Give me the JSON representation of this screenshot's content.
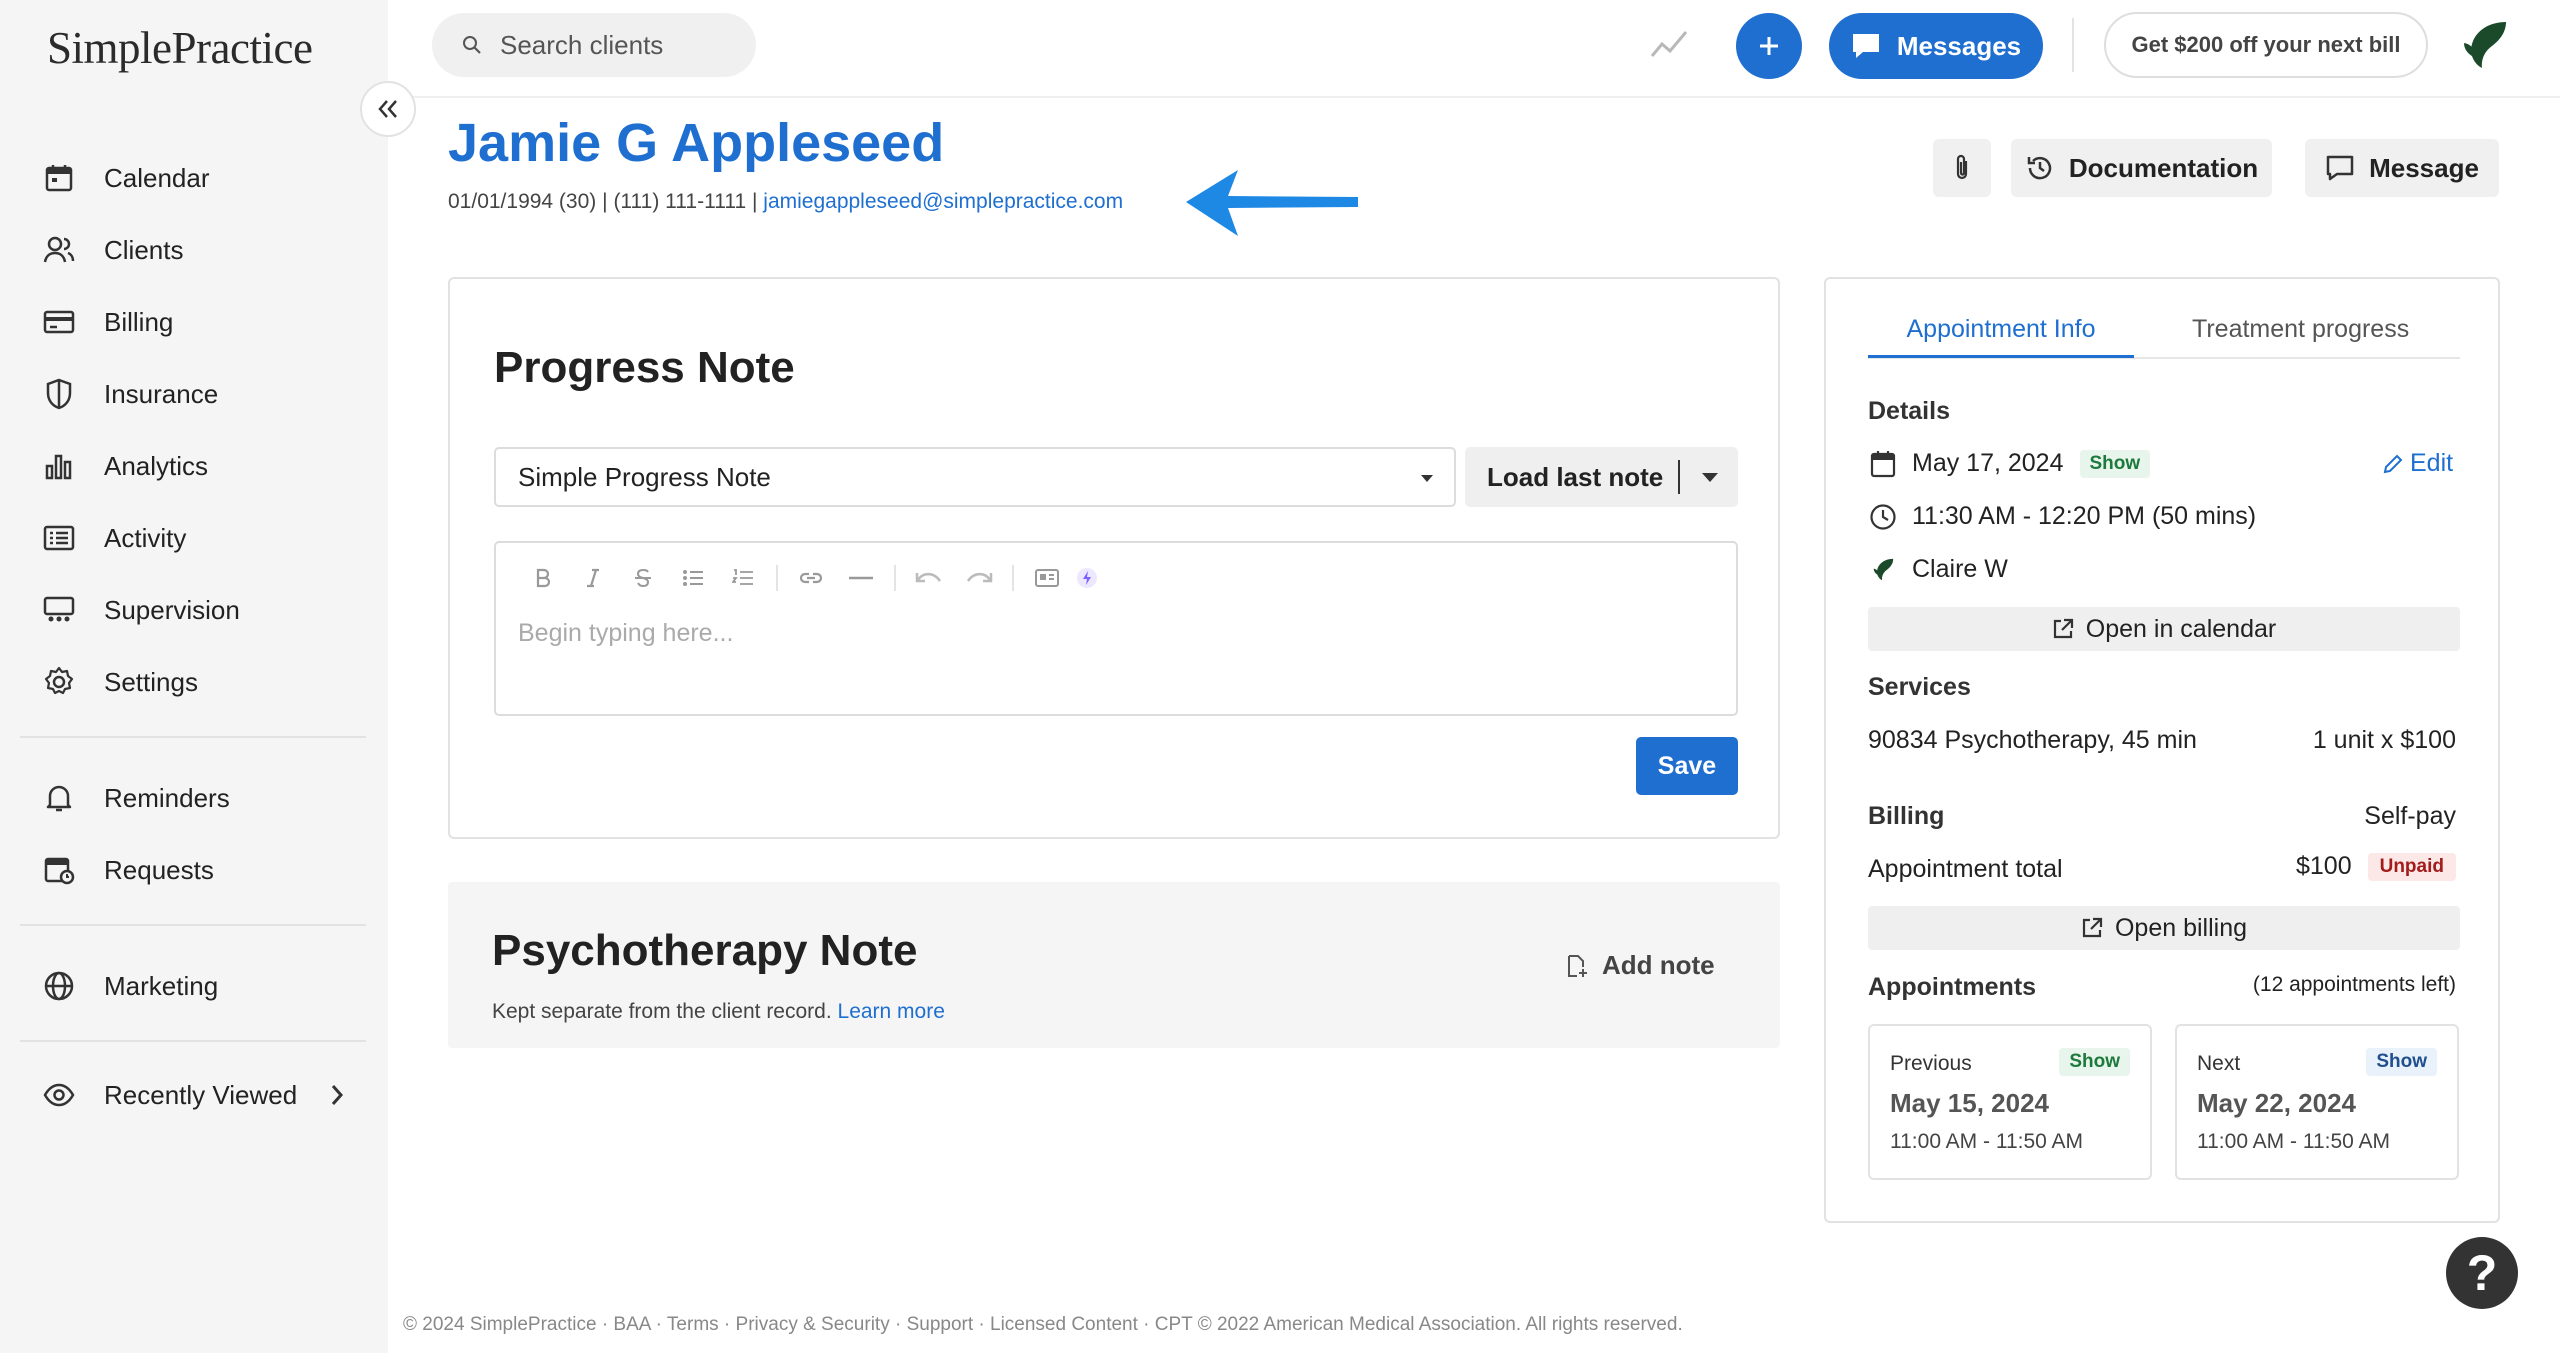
{
  "app": {
    "logo": "SimplePractice"
  },
  "sidebar": {
    "items": [
      {
        "label": "Calendar"
      },
      {
        "label": "Clients"
      },
      {
        "label": "Billing"
      },
      {
        "label": "Insurance"
      },
      {
        "label": "Analytics"
      },
      {
        "label": "Activity"
      },
      {
        "label": "Supervision"
      },
      {
        "label": "Settings"
      },
      {
        "label": "Reminders"
      },
      {
        "label": "Requests"
      },
      {
        "label": "Marketing"
      },
      {
        "label": "Recently Viewed"
      }
    ]
  },
  "header": {
    "search_placeholder": "Search clients",
    "messages_label": "Messages",
    "promo_label": "Get $200 off your next bill"
  },
  "client": {
    "name": "Jamie G Appleseed",
    "dob": "01/01/1994 (30)",
    "phone": "(111) 111-1111",
    "email": "jamiegappleseed@simplepractice.com",
    "documentation_label": "Documentation",
    "message_label": "Message"
  },
  "progress_note": {
    "title": "Progress Note",
    "template": "Simple Progress Note",
    "load_last_label": "Load last note",
    "placeholder": "Begin typing here...",
    "save_label": "Save"
  },
  "psychotherapy_note": {
    "title": "Psychotherapy Note",
    "subtitle": "Kept separate from the client record.",
    "learn_more": "Learn more",
    "add_note_label": "Add note"
  },
  "panel": {
    "tabs": [
      "Appointment Info",
      "Treatment progress"
    ],
    "details_heading": "Details",
    "date": "May 17, 2024",
    "status": "Show",
    "edit_label": "Edit",
    "time": "11:30 AM - 12:20 PM (50 mins)",
    "clinician": "Claire W",
    "open_calendar": "Open in calendar",
    "services_heading": "Services",
    "service": "90834 Psychotherapy, 45 min",
    "service_units": "1 unit x $100",
    "billing_heading": "Billing",
    "billing_type": "Self-pay",
    "appointment_total_label": "Appointment total",
    "appointment_total": "$100",
    "payment_status": "Unpaid",
    "open_billing": "Open billing",
    "appointments_heading": "Appointments",
    "appointments_left": "(12 appointments left)",
    "previous": {
      "label": "Previous",
      "status": "Show",
      "date": "May 15, 2024",
      "time": "11:00 AM - 11:50 AM"
    },
    "next": {
      "label": "Next",
      "status": "Show",
      "date": "May 22, 2024",
      "time": "11:00 AM - 11:50 AM"
    }
  },
  "footer": {
    "text": "© 2024 SimplePractice · BAA · Terms · Privacy & Security · Support · Licensed Content · CPT © 2022 American Medical Association. All rights reserved."
  },
  "help": {
    "label": "?"
  },
  "colors": {
    "accent": "#1e6fd0",
    "sidebar_bg": "#f5f5f5",
    "show_badge": "#1d7a3c",
    "unpaid_badge": "#a21c1c"
  }
}
